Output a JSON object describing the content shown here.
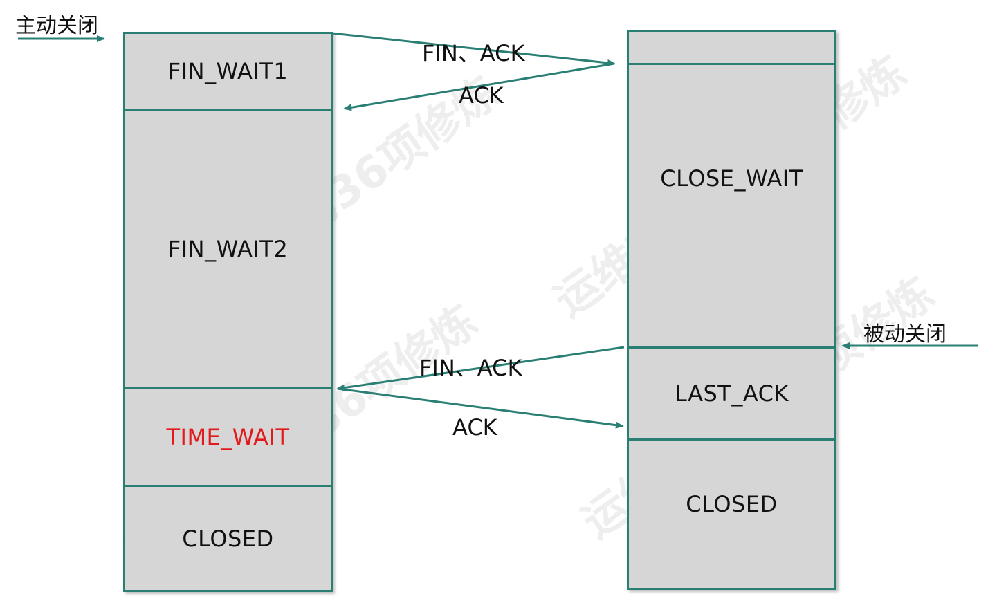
{
  "left_side_label": "主动关闭",
  "right_side_label": "被动关闭",
  "left_states": {
    "fin_wait1": "FIN_WAIT1",
    "fin_wait2": "FIN_WAIT2",
    "time_wait": "TIME_WAIT",
    "closed": "CLOSED"
  },
  "right_states": {
    "close_wait": "CLOSE_WAIT",
    "last_ack": "LAST_ACK",
    "closed": "CLOSED"
  },
  "messages": {
    "first_fin": "FIN、ACK",
    "first_ack": "ACK",
    "second_fin": "FIN、ACK",
    "second_ack": "ACK"
  },
  "watermark": "运维高手的36项修炼",
  "colors": {
    "line": "#2a7f74",
    "box_fill": "#d6d6d6",
    "time_wait_text": "#e3191b"
  }
}
